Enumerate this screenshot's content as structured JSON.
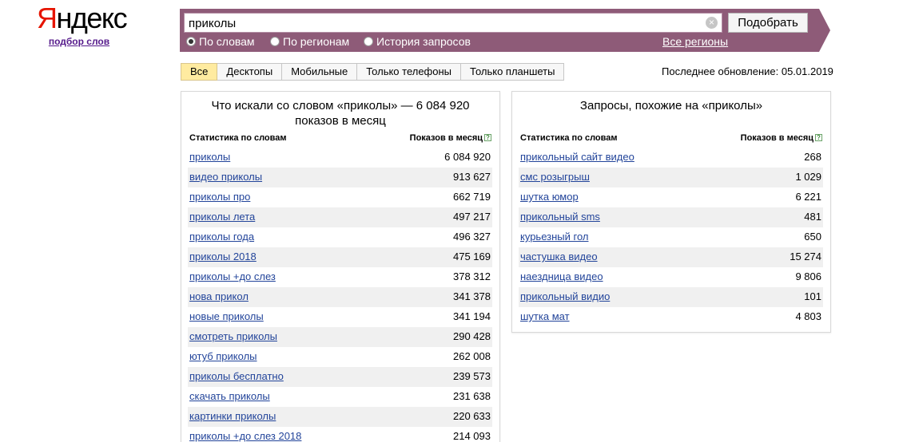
{
  "logo": {
    "text_first": "Я",
    "text_rest": "ндекс",
    "subtitle": "подбор слов"
  },
  "search": {
    "value": "приколы",
    "button_label": "Подобрать",
    "clear_icon": "×",
    "options": [
      {
        "label": "По словам",
        "selected": true
      },
      {
        "label": "По регионам",
        "selected": false
      },
      {
        "label": "История запросов",
        "selected": false
      }
    ],
    "regions_link": "Все регионы"
  },
  "tabs": [
    {
      "label": "Все",
      "active": true
    },
    {
      "label": "Десктопы",
      "active": false
    },
    {
      "label": "Мобильные",
      "active": false
    },
    {
      "label": "Только телефоны",
      "active": false
    },
    {
      "label": "Только планшеты",
      "active": false
    }
  ],
  "last_update": "Последнее обновление: 05.01.2019",
  "left_panel": {
    "title": "Что искали со словом «приколы» — 6 084 920 показов в месяц",
    "col_words": "Статистика по словам",
    "col_shows": "Показов в месяц",
    "help_icon": "?",
    "rows": [
      {
        "keyword": "приколы",
        "shows": "6 084 920"
      },
      {
        "keyword": "видео приколы",
        "shows": "913 627"
      },
      {
        "keyword": "приколы про",
        "shows": "662 719"
      },
      {
        "keyword": "приколы лета",
        "shows": "497 217"
      },
      {
        "keyword": "приколы года",
        "shows": "496 327"
      },
      {
        "keyword": "приколы 2018",
        "shows": "475 169"
      },
      {
        "keyword": "приколы +до слез",
        "shows": "378 312"
      },
      {
        "keyword": "нова прикол",
        "shows": "341 378"
      },
      {
        "keyword": "новые приколы",
        "shows": "341 194"
      },
      {
        "keyword": "смотреть приколы",
        "shows": "290 428"
      },
      {
        "keyword": "ютуб приколы",
        "shows": "262 008"
      },
      {
        "keyword": "приколы бесплатно",
        "shows": "239 573"
      },
      {
        "keyword": "скачать приколы",
        "shows": "231 638"
      },
      {
        "keyword": "картинки приколы",
        "shows": "220 633"
      },
      {
        "keyword": "приколы +до слез 2018",
        "shows": "214 093"
      }
    ]
  },
  "right_panel": {
    "title": "Запросы, похожие на «приколы»",
    "col_words": "Статистика по словам",
    "col_shows": "Показов в месяц",
    "help_icon": "?",
    "rows": [
      {
        "keyword": "прикольный сайт видео",
        "shows": "268"
      },
      {
        "keyword": "смс розыгрыш",
        "shows": "1 029"
      },
      {
        "keyword": "шутка юмор",
        "shows": "6 221"
      },
      {
        "keyword": "прикольный sms",
        "shows": "481"
      },
      {
        "keyword": "курьезный гол",
        "shows": "650"
      },
      {
        "keyword": "частушка видео",
        "shows": "15 274"
      },
      {
        "keyword": "наездница видео",
        "shows": "9 806"
      },
      {
        "keyword": "прикольный видио",
        "shows": "101"
      },
      {
        "keyword": "шутка мат",
        "shows": "4 803"
      }
    ]
  }
}
